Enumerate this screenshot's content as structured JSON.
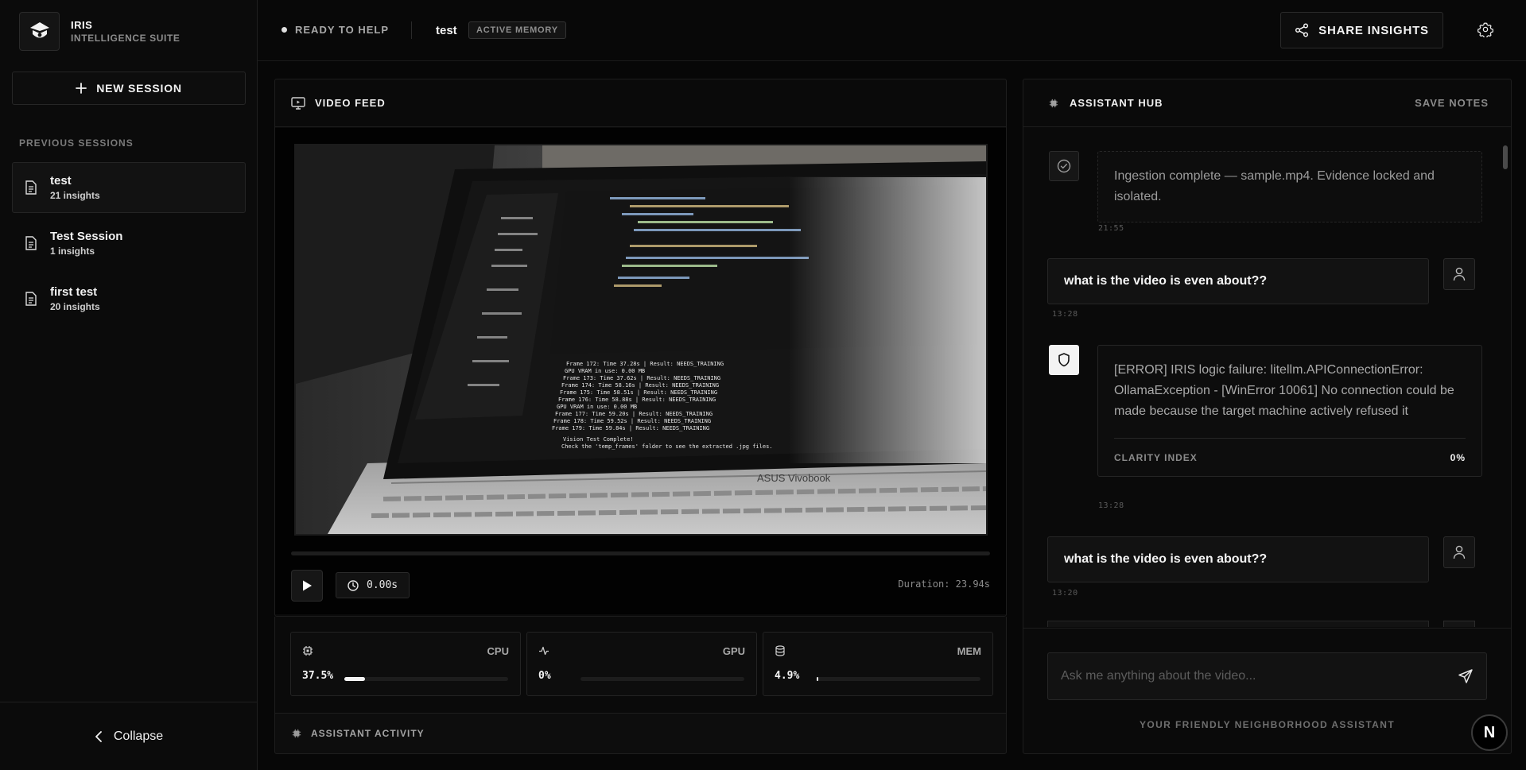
{
  "brand": {
    "name": "IRIS",
    "subtitle": "INTELLIGENCE SUITE"
  },
  "sidebar": {
    "new_session_label": "NEW SESSION",
    "previous_heading": "PREVIOUS SESSIONS",
    "sessions": [
      {
        "title": "test",
        "count": "21 insights",
        "active": true
      },
      {
        "title": "Test Session",
        "count": "1 insights",
        "active": false
      },
      {
        "title": "first test",
        "count": "20 insights",
        "active": false
      }
    ],
    "collapse_label": "Collapse"
  },
  "topbar": {
    "status": "READY TO HELP",
    "session_name": "test",
    "memory_badge": "ACTIVE MEMORY",
    "share_label": "SHARE INSIGHTS"
  },
  "video": {
    "title": "VIDEO FEED",
    "current_time": "0.00s",
    "duration": "Duration: 23.94s",
    "progress": 0
  },
  "metrics": [
    {
      "label": "CPU",
      "value": "37.5%",
      "fraction": 0.125,
      "icon": "cpu-icon"
    },
    {
      "label": "GPU",
      "value": "0%",
      "fraction": 0,
      "icon": "activity-icon"
    },
    {
      "label": "MEM",
      "value": "4.9%",
      "fraction": 0.012,
      "icon": "database-icon"
    }
  ],
  "activity_label": "ASSISTANT ACTIVITY",
  "hub": {
    "title": "ASSISTANT HUB",
    "save_label": "SAVE NOTES",
    "messages": [
      {
        "role": "assistant",
        "text": "Ingestion complete — sample.mp4. Evidence locked and isolated.",
        "time": "21:55"
      },
      {
        "role": "user",
        "text": "what is the video is even about??",
        "time": "13:28"
      },
      {
        "role": "assistant",
        "text": "[ERROR] IRIS logic failure: litellm.APIConnectionError: OllamaException - [WinError 10061] No connection could be made because the target machine actively refused it",
        "clarity_label": "CLARITY INDEX",
        "clarity_value": "0%",
        "time": "13:28"
      },
      {
        "role": "user",
        "text": "what is the video is even about??",
        "time": "13:20"
      }
    ],
    "input_placeholder": "Ask me anything about the video...",
    "tagline": "YOUR FRIENDLY NEIGHBORHOOD ASSISTANT"
  },
  "corner_badge": "N",
  "screen_content": {
    "laptop_brand": "ASUS Vivobook",
    "terminal_lines": [
      "Frame 172: Time 37.28s | Result: NEEDS_TRAINING",
      "GPU VRAM in use: 0.00 MB",
      "Frame 173: Time 37.62s | Result: NEEDS_TRAINING",
      "Frame 174: Time 58.16s | Result: NEEDS_TRAINING",
      "Frame 175: Time 58.51s | Result: NEEDS_TRAINING",
      "Frame 176: Time 58.88s | Result: NEEDS_TRAINING",
      "GPU VRAM in use: 0.00 MB",
      "Frame 177: Time 59.20s | Result: NEEDS_TRAINING",
      "Frame 178: Time 59.52s | Result: NEEDS_TRAINING",
      "Frame 179: Time 59.84s | Result: NEEDS_TRAINING",
      "Vision Test Complete!",
      "Check the 'temp_frames' folder to see the extracted .jpg files."
    ]
  }
}
